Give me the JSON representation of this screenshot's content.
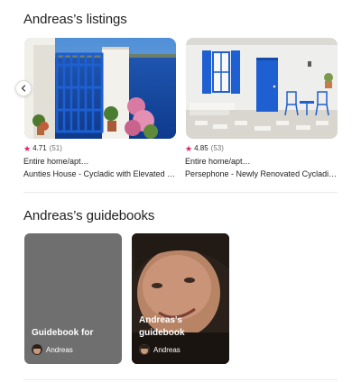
{
  "listings_section": {
    "title": "Andreas’s listings",
    "items": [
      {
        "rating": "4.71",
        "reviews": "(51)",
        "type": "Entire home/apt…",
        "name": "Aunties House - Cycladic with Elevated …"
      },
      {
        "rating": "4.85",
        "reviews": "(53)",
        "type": "Entire home/apt…",
        "name": "Persephone - Newly Renovated Cycladic…"
      }
    ]
  },
  "guidebooks_section": {
    "title": "Andreas’s guidebooks",
    "items": [
      {
        "title": "Guidebook for",
        "author": "Andreas"
      },
      {
        "title": "Andreas's guidebook",
        "author": "Andreas"
      }
    ]
  },
  "icons": {
    "prev": "chevron-left-icon",
    "rating": "star-icon"
  },
  "colors": {
    "star": "#e31c5f",
    "muted_text": "#717171",
    "divider": "#ebebeb"
  }
}
